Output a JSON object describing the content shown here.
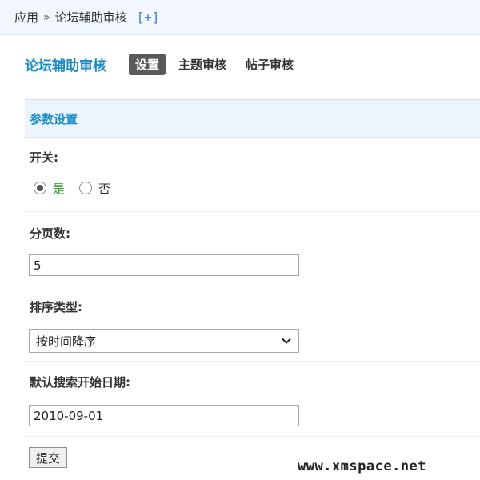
{
  "breadcrumb": {
    "root": "应用",
    "separator": "»",
    "current": "论坛辅助审核",
    "add_label": "[+]"
  },
  "header": {
    "title": "论坛辅助审核",
    "tabs": [
      {
        "label": "设置",
        "active": true
      },
      {
        "label": "主题审核",
        "active": false
      },
      {
        "label": "帖子审核",
        "active": false
      }
    ]
  },
  "section": {
    "title": "参数设置"
  },
  "form": {
    "switch": {
      "label": "开关:",
      "options": [
        {
          "label": "是",
          "checked": true
        },
        {
          "label": "否",
          "checked": false
        }
      ]
    },
    "page_size": {
      "label": "分页数:",
      "value": "5"
    },
    "sort_type": {
      "label": "排序类型:",
      "selected": "按时间降序"
    },
    "default_search_date": {
      "label": "默认搜索开始日期:",
      "value": "2010-09-01"
    },
    "submit_label": "提交"
  },
  "watermark": "www.xmspace.net",
  "colors": {
    "accent": "#1b8bc7",
    "breadcrumb_bg": "#f2f8fd",
    "section_bg": "#edf5fc",
    "active_tab_bg": "#5a5a5a",
    "yes_label": "#3aa33a"
  }
}
